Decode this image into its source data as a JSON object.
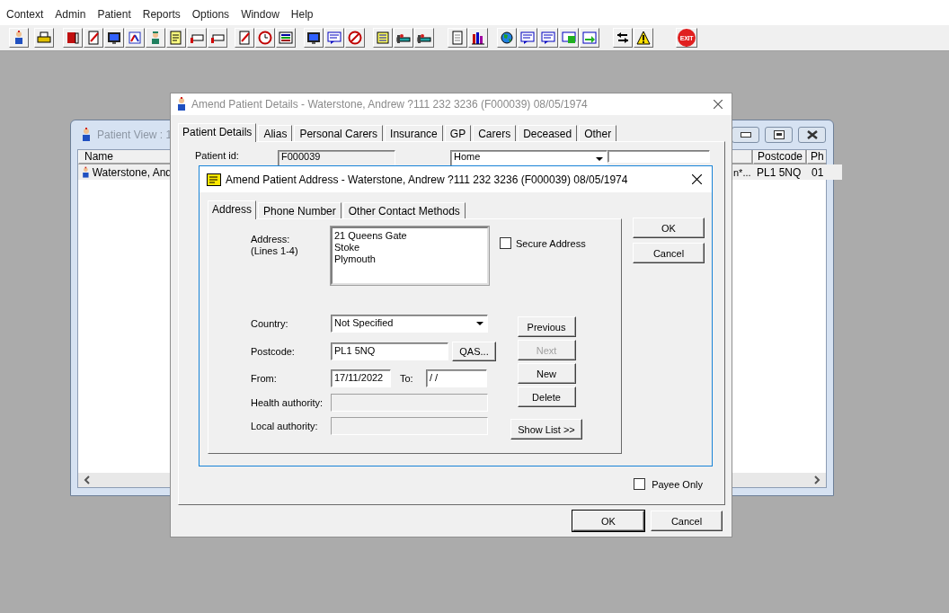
{
  "menu_bar": [
    {
      "label": "Context"
    },
    {
      "label": "Admin"
    },
    {
      "label": "Patient"
    },
    {
      "label": "Reports"
    },
    {
      "label": "Options"
    },
    {
      "label": "Window"
    },
    {
      "label": "Help"
    }
  ],
  "toolbar": {
    "exit_label": "EXIT"
  },
  "patient_view": {
    "title": "Patient View : 1",
    "columns": [
      {
        "label": "Name"
      },
      {
        "label": "Postcode"
      },
      {
        "label": "Ph"
      }
    ],
    "rows": [
      {
        "name": "Waterstone, And",
        "column_3": "n*...",
        "postcode": "PL1 5NQ",
        "ph": "01",
        "selected": true
      }
    ]
  },
  "amend_details": {
    "title": "Amend Patient Details - Waterstone, Andrew ?111 232 3236 (F000039) 08/05/1974",
    "tabs": [
      {
        "label": "Patient Details",
        "selected": true
      },
      {
        "label": "Alias",
        "selected": false
      },
      {
        "label": "Personal Carers",
        "selected": false
      },
      {
        "label": "Insurance",
        "selected": false
      },
      {
        "label": "GP",
        "selected": false
      },
      {
        "label": "Carers",
        "selected": false
      },
      {
        "label": "Deceased",
        "selected": false
      },
      {
        "label": "Other",
        "selected": false
      }
    ],
    "patient_id_label": "Patient id:",
    "patient_id": "F000039",
    "address_type": "Home",
    "payee_only": {
      "label": "Payee Only",
      "checked": false
    },
    "buttons": [
      {
        "label": "OK",
        "default": true
      },
      {
        "label": "Cancel",
        "default": false
      }
    ]
  },
  "amend_address": {
    "title": "Amend Patient  Address - Waterstone, Andrew ?111 232 3236 (F000039) 08/05/1974",
    "tabs": [
      {
        "label": "Address",
        "selected": true
      },
      {
        "label": "Phone Number",
        "selected": false
      },
      {
        "label": "Other Contact Methods",
        "selected": false
      }
    ],
    "address_label": "Address:",
    "address_hint": "(Lines 1-4)",
    "address_lines": [
      "21 Queens Gate",
      "Stoke",
      "Plymouth"
    ],
    "secure_address": {
      "label": "Secure Address",
      "checked": false
    },
    "fields": [
      {
        "kind": "select",
        "label": "Country:",
        "value": "Not Specified"
      },
      {
        "kind": "lookup",
        "label": "Postcode:",
        "value": "PL1 5NQ",
        "button": "QAS..."
      },
      {
        "kind": "range",
        "label": "From:",
        "value": "17/11/2022",
        "to_label": "To:",
        "to_value": "/ /"
      },
      {
        "kind": "readonly",
        "label": "Health authority:"
      },
      {
        "kind": "readonly",
        "label": "Local authority:"
      }
    ],
    "nav_buttons": [
      {
        "label": "Previous",
        "disabled": false
      },
      {
        "label": "Next",
        "disabled": true
      },
      {
        "label": "New",
        "disabled": false
      },
      {
        "label": "Delete",
        "disabled": false
      }
    ],
    "show_list": "Show List >>",
    "buttons": [
      {
        "label": "OK"
      },
      {
        "label": "Cancel"
      }
    ]
  }
}
